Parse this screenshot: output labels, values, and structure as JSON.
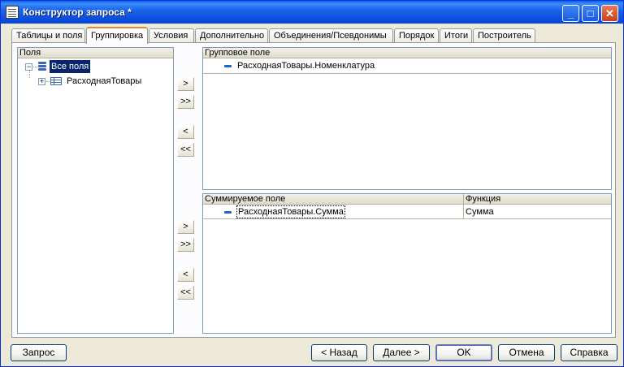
{
  "window": {
    "title": "Конструктор запроса *",
    "controls": {
      "minimize": "_",
      "maximize": "□",
      "close": "✕"
    }
  },
  "tabs": [
    {
      "label": "Таблицы и поля"
    },
    {
      "label": "Группировка"
    },
    {
      "label": "Условия"
    },
    {
      "label": "Дополнительно"
    },
    {
      "label": "Объединения/Псевдонимы"
    },
    {
      "label": "Порядок"
    },
    {
      "label": "Итоги"
    },
    {
      "label": "Построитель"
    }
  ],
  "active_tab": "Группировка",
  "fields_panel": {
    "header": "Поля",
    "tree": [
      {
        "label": "Все поля",
        "expander": "−",
        "selected": true,
        "icon": "database-icon"
      },
      {
        "label": "РасходнаяТовары",
        "expander": "+",
        "selected": false,
        "icon": "table-icon"
      }
    ]
  },
  "transfer_buttons": {
    "move_one": ">",
    "move_all": ">>",
    "remove_one": "<",
    "remove_all": "<<"
  },
  "group_panel": {
    "header": "Групповое поле",
    "rows": [
      {
        "field": "РасходнаяТовары.Номенклатура"
      }
    ]
  },
  "sum_panel": {
    "headers": {
      "field": "Суммируемое поле",
      "function": "Функция"
    },
    "rows": [
      {
        "field": "РасходнаяТовары.Сумма",
        "function": "Сумма"
      }
    ]
  },
  "footer": {
    "query": "Запрос",
    "back": "< Назад",
    "next": "Далее >",
    "ok": "OK",
    "cancel": "Отмена",
    "help": "Справка"
  }
}
